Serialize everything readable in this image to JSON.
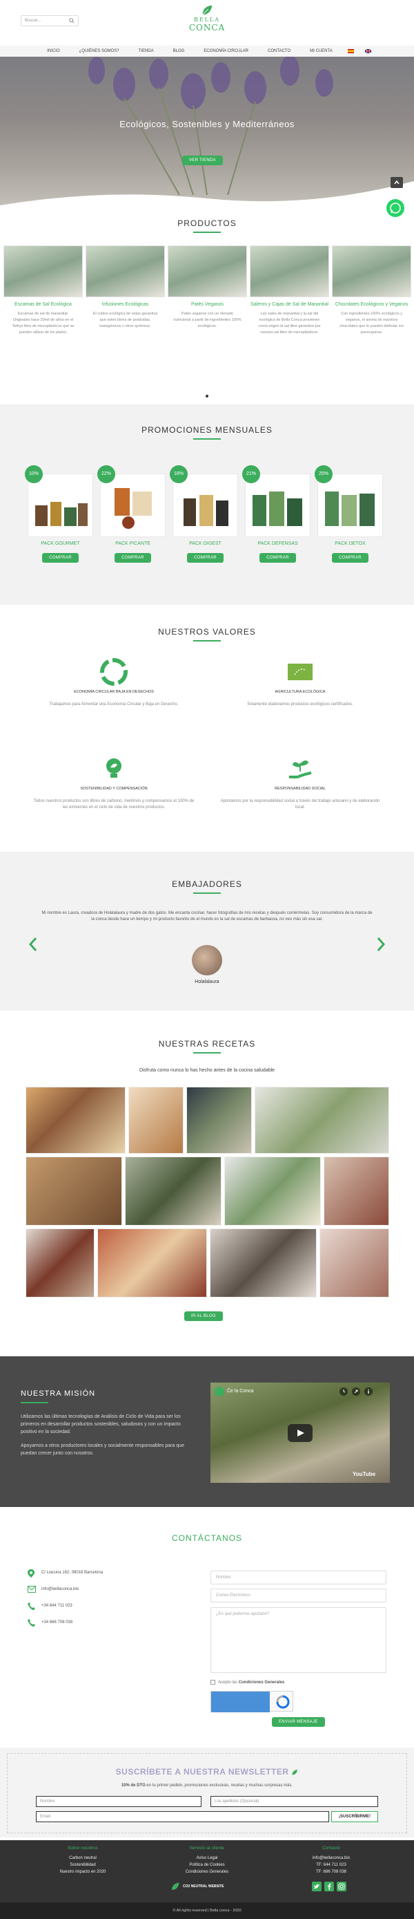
{
  "header": {
    "search_placeholder": "Buscar...",
    "logo_top": "BELLA",
    "logo_bottom": "CONCA"
  },
  "nav": {
    "items": [
      "INICIO",
      "¿QUIÉNES SOMOS?",
      "TIENDA",
      "BLOG",
      "ECONOMÍA CIRCULAR",
      "CONTACTO",
      "MI CUENTA"
    ]
  },
  "hero": {
    "title": "Ecológicos, Sostenibles y Mediterráneos",
    "button": "VER TIENDA"
  },
  "products": {
    "heading": "PRODUCTOS",
    "items": [
      {
        "name": "Escamas de Sal Ecológica",
        "desc": "Escamas de sal de manantial. Originales hace 20mil de años en el Tethys libre de microplásticos que se pueden utilizar de los platos."
      },
      {
        "name": "Infusiones Ecológicas",
        "desc": "El cultivo ecológico de estas garantiza que estén libres de pesticidas, transgénicos u otros químicos."
      },
      {
        "name": "Patés Veganos",
        "desc": "Patés veganos con un elevado nutricional a partir de ingredientes 100% ecológicos."
      },
      {
        "name": "Saleros y Cajas de Sal de Manantial",
        "desc": "Las sales de manantial y la sal del ecológica de Bella Conca provienen como origen la sal libre garantiza por nuestra sal libre de microplásticos."
      },
      {
        "name": "Chocolates Ecológicos y Veganos",
        "desc": "Con ingredientes 100% ecológicos y veganos, el aroma de nuestros chocolates que lo pueden disfrutar sin preocuparse."
      }
    ]
  },
  "promos": {
    "heading": "PROMOCIONES MENSUALES",
    "button": "COMPRAR",
    "items": [
      {
        "pct": "10%",
        "name": "PACK GOURMET"
      },
      {
        "pct": "22%",
        "name": "PACK PICANTE"
      },
      {
        "pct": "18%",
        "name": "PACK DIGEST"
      },
      {
        "pct": "21%",
        "name": "PACK DEFENSAS"
      },
      {
        "pct": "25%",
        "name": "PACK DETOX"
      }
    ]
  },
  "values": {
    "heading": "NUESTROS VALORES",
    "items": [
      {
        "label": "ECONOMÍA CIRCULAR BAJA EN DESECHOS",
        "text": "Trabajamos para fomentar una Economía Circular y Baja en Desecho."
      },
      {
        "label": "AGRICULTURA ECOLÓGICA",
        "text": "Solamente elaboramos productos ecológicos certificados."
      },
      {
        "label": "SOSTENIBILIDAD Y COMPENSACIÓN",
        "text": "Todos nuestros productos son libres de carbono, medimos y compensamos el 100% de las emisiones en el ciclo de vida de nuestros productos."
      },
      {
        "label": "RESPONSABILIDAD SOCIAL",
        "text": "Apostamos por la responsabilidad social a través del trabajo artesano y de elaboración local."
      }
    ]
  },
  "ambassadors": {
    "heading": "EMBAJADORES",
    "quote": "Mi nombre es Laura, creadora de Holalalaura y madre de dos gatos. Me encanta cocinar, hacer fotografías de mis recetas y después comérmelas. Soy consumidora de la marca de la conca desde hace un tiempo y mi producto favorito de el mundo es la sal de escamas de barbacoa, no veo más sin esa sal.",
    "name": "Holalalaura"
  },
  "recipes": {
    "heading": "NUESTRAS RECETAS",
    "subtitle": "Disfruta como nunca lo has hecho antes de la cocina saludable",
    "button": "IR AL BLOG"
  },
  "mission": {
    "heading": "NUESTRA MISIÓN",
    "p1": "Utilizamos las últimas tecnologías de Análisis de Ciclo de Vida para ser los primeros en desarrollar productos sostenibles, saludosos y con un impacto positivo en la sociedad.",
    "p2": "Apoyamos a otros productores locales y socialmente responsables para que puedan crecer junto con nosotros.",
    "video_title": "Če la Conca",
    "video_brand": "YouTube"
  },
  "contact": {
    "heading": "CONTÁCTANOS",
    "address": "C/ Llacuna 162, 08018 Barcelona",
    "email": "info@bellaconca.bio",
    "phone1": "+34 644 711 023",
    "phone2": "+34 686 708 038",
    "name_ph": "Nombre",
    "email_ph": "Correo Electrónico",
    "msg_ph": "¿En qué podemos ayudarte?",
    "accept_prefix": "Acepto las ",
    "accept_link": "Condiciones Generales",
    "submit": "ENVIAR MENSAJE"
  },
  "newsletter": {
    "heading": "SUSCRÍBETE A NUESTRA NEWSLETTER",
    "promo_bold": "10% de DTO",
    "promo_rest": " en tu primer pedido, promociones exclusivas, recetas y muchas sorpresas más.",
    "name_ph": "Nombre",
    "surname_ph": "Los apellidos (Opcional)",
    "email_ph": "Email",
    "button": "¡SUSCRÍBIRME!"
  },
  "footer": {
    "col1_title": "Sobre nosotros",
    "col1": [
      "Carbon neutral",
      "Sostenibilidad",
      "Nuestro impacto en 2020"
    ],
    "col2_title": "Servicio al cliente",
    "col2": [
      "Aviso Legal",
      "Política de Cookies",
      "Condiciones Generales"
    ],
    "col3_title": "Contacto",
    "col3": [
      "info@bellaconca.bio",
      "TF: 644 711 023",
      "TF: 686 708 038"
    ],
    "badge": "CO2 NEUTRAL WEBSITE",
    "copyright": "© All rights reserved | Bella conca - 2020"
  },
  "colors": {
    "accent": "#3cad5d",
    "dark": "#4a4a4a"
  }
}
